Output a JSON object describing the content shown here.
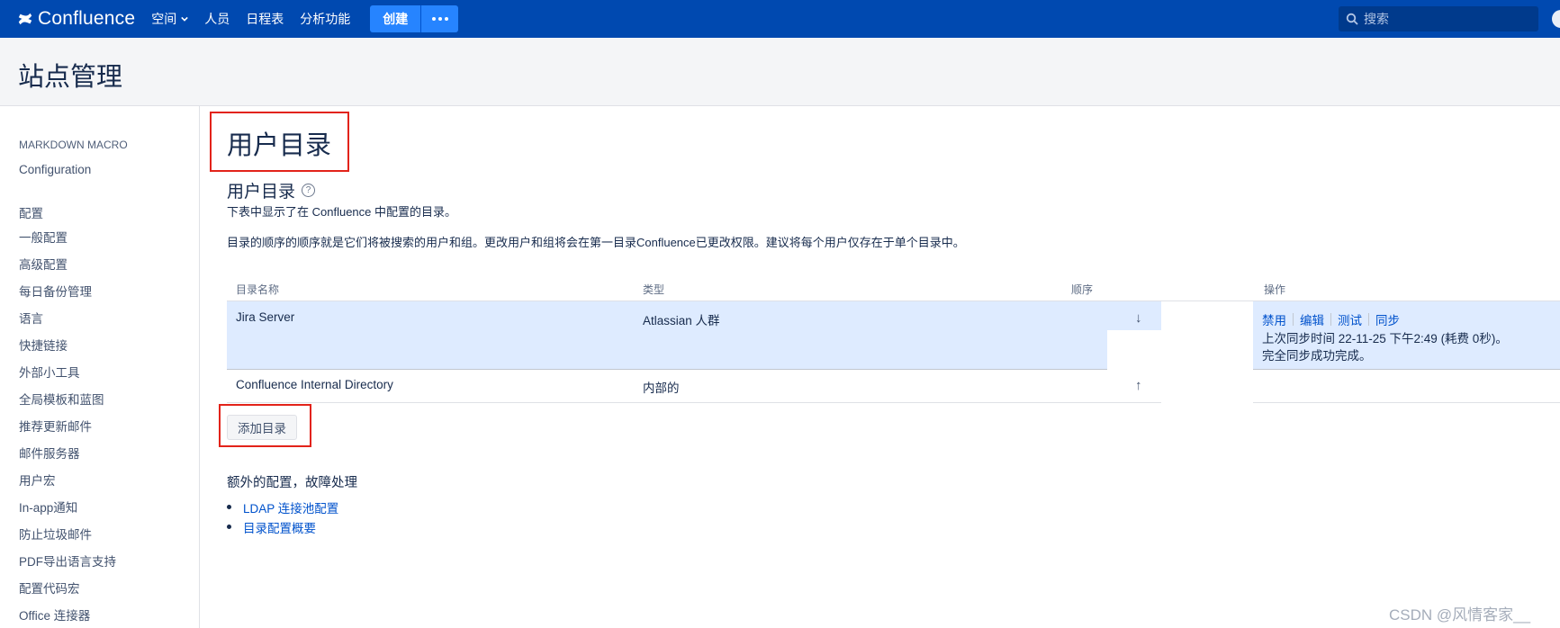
{
  "topnav": {
    "brand": "Confluence",
    "items": [
      {
        "label": "空间",
        "has_dropdown": true
      },
      {
        "label": "人员"
      },
      {
        "label": "日程表"
      },
      {
        "label": "分析功能"
      }
    ],
    "create_label": "创建",
    "more_icon": "more-dots-icon",
    "search_placeholder": "搜索"
  },
  "header": {
    "title": "站点管理"
  },
  "sidebar": {
    "groups": [
      {
        "title": "MARKDOWN MACRO",
        "items": [
          "Configuration"
        ]
      },
      {
        "title": "配置",
        "items": [
          "一般配置",
          "高级配置",
          "每日备份管理",
          "语言",
          "快捷链接",
          "外部小工具",
          "全局模板和蓝图",
          "推荐更新邮件",
          "邮件服务器",
          "用户宏",
          "In-app通知",
          "防止垃圾邮件",
          "PDF导出语言支持",
          "配置代码宏",
          "Office 连接器"
        ]
      }
    ]
  },
  "main": {
    "page_title": "用户目录",
    "section_title": "用户目录",
    "description": "下表中显示了在 Confluence 中配置的目录。",
    "order_note": "目录的顺序的顺序就是它们将被搜索的用户和组。更改用户和组将会在第一目录Confluence已更改权限。建议将每个用户仅存在于单个目录中。",
    "table": {
      "headers": [
        "目录名称",
        "类型",
        "顺序",
        "操作"
      ],
      "rows": [
        {
          "name": "Jira Server",
          "type": "Atlassian 人群",
          "order_arrow": "↓",
          "actions": [
            "禁用",
            "编辑",
            "测试",
            "同步"
          ],
          "sync_time": "上次同步时间 22-11-25 下午2:49 (耗费 0秒)。",
          "sync_status": "完全同步成功完成。"
        },
        {
          "name": "Confluence Internal Directory",
          "type": "内部的",
          "order_arrow": "↑"
        }
      ]
    },
    "add_button": "添加目录",
    "extra_title": "额外的配置，故障处理",
    "extra_links": [
      "LDAP 连接池配置",
      "目录配置概要"
    ]
  },
  "watermark": "CSDN @风情客家__",
  "colors": {
    "nav_bg": "#0049b0",
    "create_btn": "#2684ff",
    "link": "#0052cc",
    "row_highlight": "#deebff",
    "annotation": "#e2231a"
  }
}
